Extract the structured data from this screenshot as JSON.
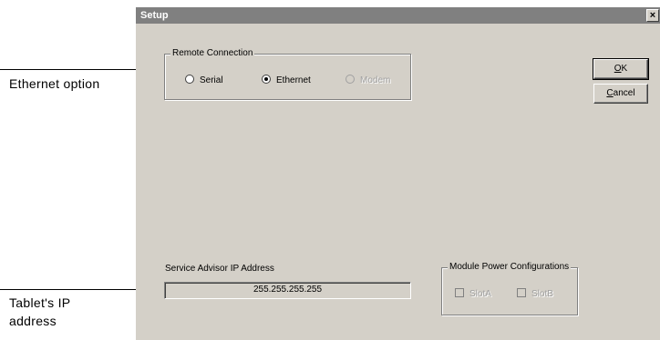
{
  "callouts": {
    "ethernet": "Ethernet option",
    "tablet_ip": "Tablet's IP address"
  },
  "window": {
    "title": "Setup",
    "close_glyph": "×"
  },
  "remote_connection": {
    "label": "Remote Connection",
    "options": [
      {
        "label": "Serial",
        "selected": false,
        "enabled": true
      },
      {
        "label": "Ethernet",
        "selected": true,
        "enabled": true
      },
      {
        "label": "Modem",
        "selected": false,
        "enabled": false
      }
    ]
  },
  "buttons": {
    "ok": {
      "mnemonic": "O",
      "rest": "K"
    },
    "cancel": {
      "mnemonic": "C",
      "rest": "ancel"
    }
  },
  "ip": {
    "label": "Service Advisor IP Address",
    "value": "255.255.255.255"
  },
  "module_power": {
    "label": "Module Power Configurations",
    "slots": [
      {
        "label": "SlotA",
        "checked": false,
        "enabled": false
      },
      {
        "label": "SlotB",
        "checked": false,
        "enabled": false
      }
    ]
  }
}
